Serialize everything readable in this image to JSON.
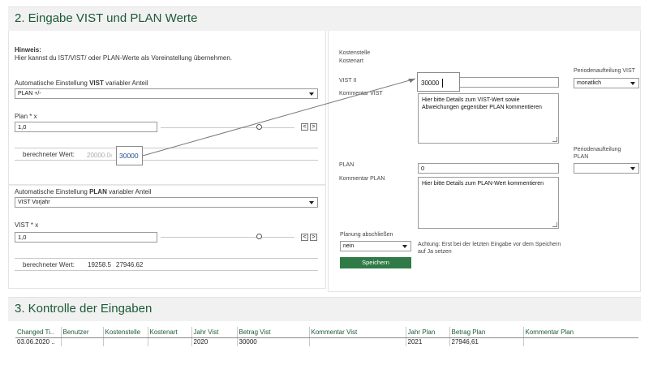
{
  "section2": {
    "title": "2. Eingabe VIST und PLAN Werte"
  },
  "hint": {
    "title": "Hinweis:",
    "text": "Hier kannst du IST/VIST/ oder PLAN-Werte als Voreinstellung übernehmen."
  },
  "vist_setting": {
    "label_prefix": "Automatische Einstellung ",
    "label_bold": "VIST",
    "label_suffix": " variabler Anteil",
    "select_value": "PLAN +/-",
    "factor_label": "Plan * x",
    "factor_value": "1,0",
    "calc_label": "berechneter Wert:",
    "calc_value_faded": "20000.0‹",
    "calc_value": "30000"
  },
  "plan_setting": {
    "label_prefix": "Automatische Einstellung ",
    "label_bold": "PLAN",
    "label_suffix": " variabler Anteil",
    "select_value": "VIST Vorjahr",
    "factor_label": "VIST * x",
    "factor_value": "1,0",
    "calc_label": "berechneter Wert:",
    "calc_value_1": "19258.5",
    "calc_value_2": "27946.62"
  },
  "stepper": {
    "prev": "<",
    "next": ">"
  },
  "right": {
    "kostenstelle_label": "Kostenstelle",
    "kostenart_label": "Kostenart",
    "vist_label": "VIST II",
    "vist_value": "30000",
    "kommentar_vist_label": "Kommentar VIST",
    "kommentar_vist_text": "Hier bitte Details zum VIST-Wert sowie Abweichungen gegenüber PLAN kommentieren",
    "period_vist_label": "Periodenaufteilung VIST",
    "period_vist_value": "monatlich",
    "plan_label": "PLAN",
    "plan_value": "0",
    "kommentar_plan_label": "Kommentar PLAN",
    "kommentar_plan_text": "Hier bitte Details zum PLAN-Wert kommentieren",
    "period_plan_label_1": "Periodenaufteilung",
    "period_plan_label_2": "PLAN",
    "period_plan_value": "",
    "abschliessen_label": "Planung abschließen",
    "abschliessen_value": "nein",
    "warning": "Achtung: Erst bei der letzten Eingabe vor dem Speichern auf Ja setzen",
    "save_label": "Speichern"
  },
  "section3": {
    "title": "3. Kontrolle der Eingaben"
  },
  "table": {
    "headers": [
      "Changed Ti..",
      "Benutzer",
      "Kostenstelle",
      "Kostenart",
      "Jahr Vist",
      "Betrag Vist",
      "Kommentar Vist",
      "Jahr Plan",
      "Betrag Plan",
      "Kommentar Plan"
    ],
    "row": [
      "03.06.2020 ..",
      "",
      "",
      "",
      "2020",
      "30000",
      "",
      "2021",
      "27946,61",
      ""
    ]
  },
  "colors": {
    "accent": "#1c5a36",
    "button": "#2f7a46",
    "link_value": "#1f4e8c"
  }
}
